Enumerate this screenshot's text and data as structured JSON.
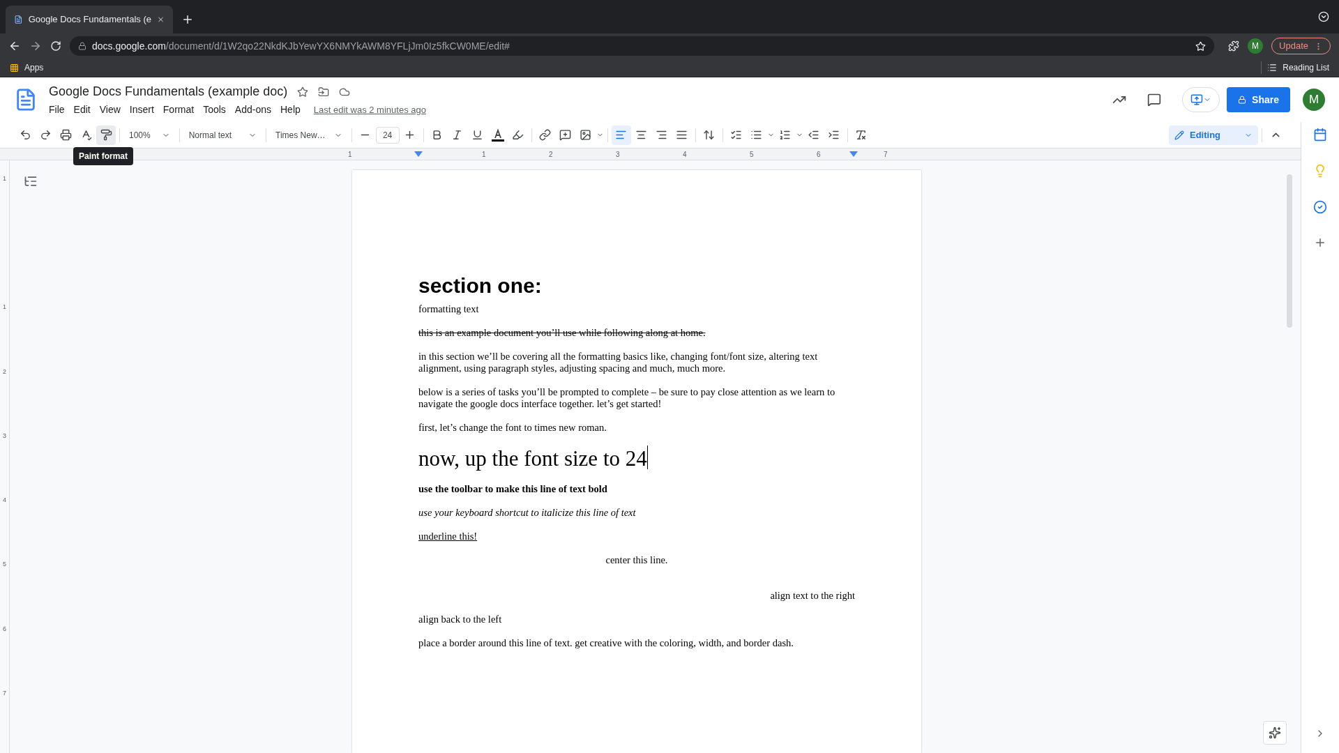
{
  "browser": {
    "tab": {
      "title": "Google Docs Fundamentals (e",
      "selected": true
    },
    "url_host": "docs.google.com",
    "url_path": "/document/d/1W2qo22NkdKJbYewYX6NMYkAWM8YFLjJm0Iz5fkCW0ME/edit#",
    "profile": "M",
    "update": "Update",
    "bookmarks": [
      "Apps"
    ],
    "reading_list": "Reading List"
  },
  "doc": {
    "title": "Google Docs Fundamentals (example doc)",
    "menus": [
      "File",
      "Edit",
      "View",
      "Insert",
      "Format",
      "Tools",
      "Add-ons",
      "Help"
    ],
    "last_edit": "Last edit was 2 minutes ago",
    "share": "Share",
    "avatar": "M"
  },
  "toolbar": {
    "zoom": "100%",
    "style": "Normal text",
    "font": "Times New…",
    "size": "24",
    "tooltip": "Paint format",
    "mode": "Editing",
    "align": [
      {
        "kind": "left",
        "selected": true
      },
      {
        "kind": "center",
        "selected": false
      },
      {
        "kind": "right",
        "selected": false
      },
      {
        "kind": "justify",
        "selected": false
      }
    ]
  },
  "ruler": {
    "labels": [
      "1",
      "1",
      "2",
      "3",
      "4",
      "5",
      "6",
      "7"
    ]
  },
  "vertical_ruler": {
    "labels": [
      "1",
      "1",
      "2",
      "3",
      "4",
      "5",
      "6",
      "7"
    ]
  },
  "paragraphs": [
    {
      "kind": "heading",
      "text": "section one:"
    },
    {
      "kind": "body",
      "text": "formatting text"
    },
    {
      "kind": "strike",
      "text": "this is an example document you’ll use while following along at home."
    },
    {
      "kind": "body",
      "text": "in this section we’ll be covering all the formatting basics like, changing font/font size, altering text alignment, using paragraph styles, adjusting spacing and much, much more."
    },
    {
      "kind": "body",
      "text": "below is a series of tasks you’ll be prompted to complete – be sure to pay close attention as we learn to navigate the google docs interface together. let’s get started!"
    },
    {
      "kind": "body",
      "text": "first, let’s change the font to times new roman."
    },
    {
      "kind": "large",
      "text": "now, up the font size to 24",
      "caret": true
    },
    {
      "kind": "bold",
      "text": "use the toolbar to make this line of text bold"
    },
    {
      "kind": "italic",
      "text": "use your keyboard shortcut to italicize this line of text"
    },
    {
      "kind": "underline",
      "text": "underline this!"
    },
    {
      "kind": "center",
      "text": "center this line."
    },
    {
      "kind": "right",
      "text": "align text to the right"
    },
    {
      "kind": "body",
      "text": "align back to the left"
    },
    {
      "kind": "body",
      "text": "place a border around this line of text. get creative with the coloring, width, and border dash."
    }
  ]
}
